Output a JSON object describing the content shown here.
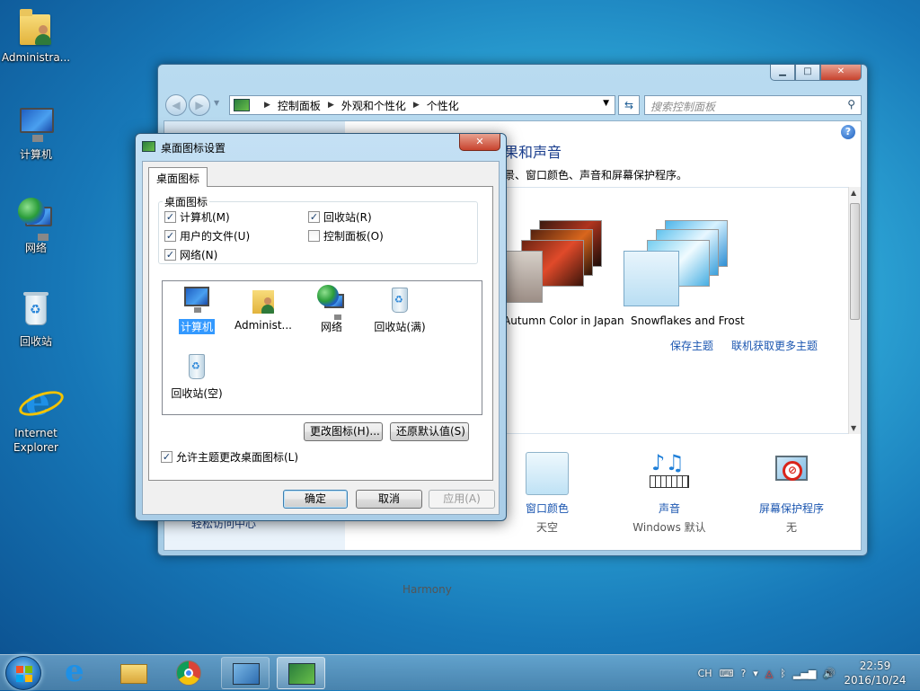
{
  "desktop": {
    "icons": [
      {
        "label": "Administra..."
      },
      {
        "label": "计算机"
      },
      {
        "label": "网络"
      },
      {
        "label": "回收站"
      },
      {
        "label": "Internet Explorer"
      }
    ]
  },
  "control_panel": {
    "breadcrumb": [
      "控制面板",
      "外观和个性化",
      "个性化"
    ],
    "search_placeholder": "搜索控制面板",
    "heading_partial": "果和声音",
    "subheading_partial": "景、窗口颜色、声音和屏幕保护程序。",
    "themes": [
      {
        "name": "Autumn Color in Japan"
      },
      {
        "name": "Snowflakes and Frost"
      }
    ],
    "links": {
      "save_theme": "保存主题",
      "more_themes": "联机获取更多主题"
    },
    "left_link": "轻松访问中心",
    "bottom": {
      "background_value": "Harmony",
      "window_color": {
        "title": "窗口颜色",
        "value": "天空"
      },
      "sounds": {
        "title": "声音",
        "value": "Windows 默认"
      },
      "screensaver": {
        "title": "屏幕保护程序",
        "value": "无"
      }
    }
  },
  "dialog": {
    "title": "桌面图标设置",
    "tab": "桌面图标",
    "group_title": "桌面图标",
    "checkboxes": [
      {
        "label": "计算机(M)",
        "checked": true
      },
      {
        "label": "回收站(R)",
        "checked": true
      },
      {
        "label": "用户的文件(U)",
        "checked": true
      },
      {
        "label": "控制面板(O)",
        "checked": false
      },
      {
        "label": "网络(N)",
        "checked": true
      }
    ],
    "icon_list": [
      {
        "label": "计算机",
        "icon": "computer-icon",
        "selected": true
      },
      {
        "label": "Administ...",
        "icon": "user-folder-icon",
        "selected": false
      },
      {
        "label": "网络",
        "icon": "network-icon",
        "selected": false
      },
      {
        "label": "回收站(满)",
        "icon": "recycle-bin-full-icon",
        "selected": false
      },
      {
        "label": "回收站(空)",
        "icon": "recycle-bin-empty-icon",
        "selected": false
      }
    ],
    "change_icon": "更改图标(H)...",
    "restore_default": "还原默认值(S)",
    "allow_themes": {
      "label": "允许主题更改桌面图标(L)",
      "checked": true
    },
    "ok": "确定",
    "cancel": "取消",
    "apply": "应用(A)"
  },
  "taskbar": {
    "tray": {
      "lang": "CH"
    },
    "clock": {
      "time": "22:59",
      "date": "2016/10/24"
    }
  },
  "colors": {
    "link": "#1b56b0",
    "selection": "#3399ff"
  }
}
